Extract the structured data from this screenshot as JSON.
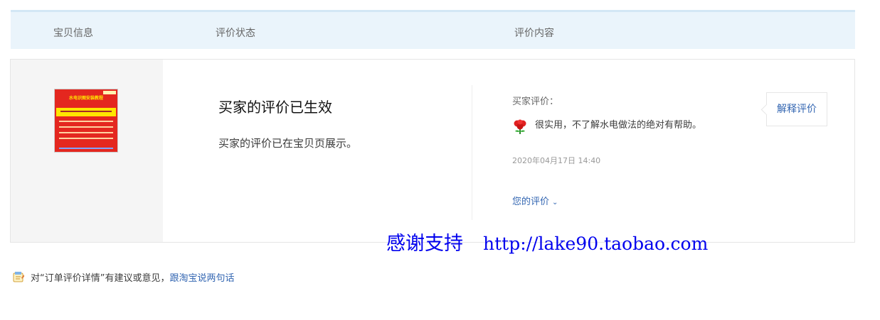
{
  "header": {
    "col_item": "宝贝信息",
    "col_status": "评价状态",
    "col_content": "评价内容"
  },
  "status": {
    "title": "买家的评价已生效",
    "description": "买家的评价已在宝贝页展示。"
  },
  "review": {
    "buyer_label": "买家评价：",
    "text": "很实用，不了解水电做法的绝对有帮助。",
    "time": "2020年04月17日 14:40",
    "your_review_label": "您的评价",
    "explain_button": "解释评价"
  },
  "watermark": {
    "text": "感谢支持",
    "url": "http://lake90.taobao.com"
  },
  "footer": {
    "feedback_prefix": "对“订单评价详情”有建议或意见，",
    "feedback_link": "跟淘宝说两句话"
  },
  "product": {
    "thumb_title": "水电识图安装教程"
  },
  "icons": {
    "feedback": "feedback-icon",
    "flower": "flower-icon",
    "chevron": "chevron-down-icon"
  },
  "colors": {
    "link": "#3366b2",
    "header_bg": "#eaf4fb",
    "watermark": "#0000ee"
  }
}
